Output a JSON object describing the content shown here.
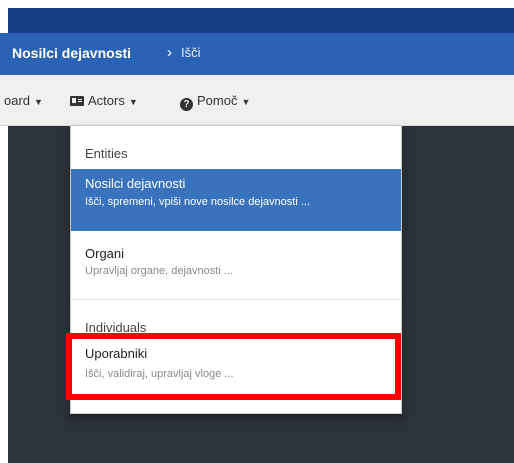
{
  "breadcrumb": {
    "main": "Nosilci dejavnosti",
    "separator": "›",
    "current": "Išči"
  },
  "menubar": {
    "board_label": "oard",
    "actors_label": "Actors",
    "help_label": "Pomoč"
  },
  "dropdown": {
    "header_entities": "Entities",
    "item_nosilci": {
      "title": "Nosilci dejavnosti",
      "desc": "Išči, spremeni, vpiši nove nosilce dejavnosti ..."
    },
    "item_organi": {
      "title": "Organi",
      "desc": "Upravljaj organe, dejavnosti ..."
    },
    "header_individuals": "Individuals",
    "item_uporabniki": {
      "title": "Uporabniki",
      "desc": "Išči, validiraj, upravljaj vloge ..."
    }
  },
  "colors": {
    "topbar": "#173f88",
    "breadcrumb_bg": "#2a63b4",
    "menubar_bg": "#f0f0f0",
    "content_bg": "#2c333a",
    "active_item": "#3a73bd",
    "highlight": "#ff0000"
  }
}
